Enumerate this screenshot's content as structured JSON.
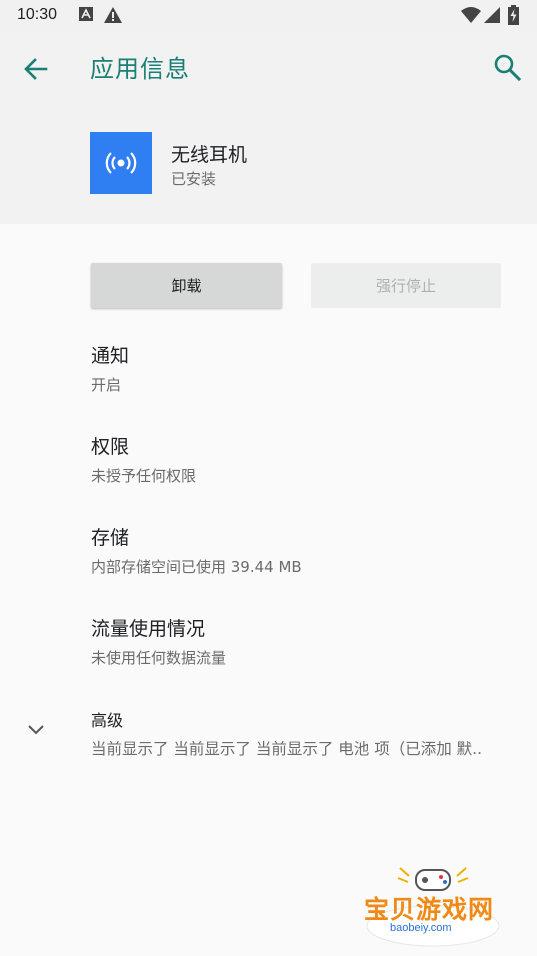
{
  "status_bar": {
    "time": "10:30",
    "icons": [
      "a-notification-icon",
      "warning-icon",
      "wifi-icon",
      "signal-icon",
      "battery-charging-icon"
    ]
  },
  "header": {
    "title": "应用信息",
    "back_icon": "arrow-back-icon",
    "search_icon": "search-icon",
    "accent_color": "#1a7f74"
  },
  "app": {
    "name": "无线耳机",
    "status": "已安装",
    "icon": "broadcast-icon",
    "icon_color": "#2f7ff3"
  },
  "buttons": {
    "uninstall": "卸载",
    "force_stop": "强行停止"
  },
  "prefs": [
    {
      "title": "通知",
      "summary": "开启"
    },
    {
      "title": "权限",
      "summary": "未授予任何权限"
    },
    {
      "title": "存储",
      "summary": "内部存储空间已使用 39.44 MB"
    },
    {
      "title": "流量使用情况",
      "summary": "未使用任何数据流量"
    }
  ],
  "advanced": {
    "title": "高级",
    "summary": "当前显示了 当前显示了 当前显示了 电池 项（已添加 默.."
  },
  "watermark": {
    "text": "宝贝游戏网",
    "url": "baobeiy.com"
  }
}
